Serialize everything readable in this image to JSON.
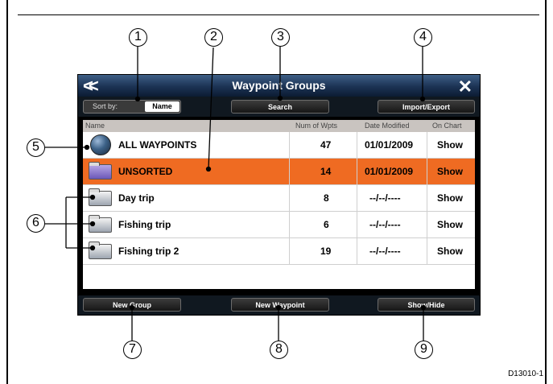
{
  "window": {
    "title": "Waypoint Groups"
  },
  "icons": {
    "back": "double-chevron-left-icon",
    "close": "close-x-icon"
  },
  "toolbar": {
    "sort_label": "Sort by:",
    "sort_value": "Name",
    "search_label": "Search",
    "import_export_label": "Import/Export"
  },
  "table": {
    "headers": [
      "Name",
      "Num of Wpts",
      "Date Modified",
      "On Chart"
    ],
    "rows": [
      {
        "name": "ALL WAYPOINTS",
        "num": "47",
        "date": "01/01/2009",
        "on_chart": "Show",
        "icon": "globe-icon"
      },
      {
        "name": "UNSORTED",
        "num": "14",
        "date": "01/01/2009",
        "on_chart": "Show",
        "icon": "folder-icon"
      },
      {
        "name": "Day trip",
        "num": "8",
        "date": "--/--/----",
        "on_chart": "Show",
        "icon": "folder-icon"
      },
      {
        "name": "Fishing trip",
        "num": "6",
        "date": "--/--/----",
        "on_chart": "Show",
        "icon": "folder-icon"
      },
      {
        "name": "Fishing trip 2",
        "num": "19",
        "date": "--/--/----",
        "on_chart": "Show",
        "icon": "folder-icon"
      }
    ]
  },
  "bottom": {
    "new_group_label": "New Group",
    "new_waypoint_label": "New Waypoint",
    "show_hide_label": "Show/Hide"
  },
  "callouts": [
    "1",
    "2",
    "3",
    "4",
    "5",
    "6",
    "7",
    "8",
    "9"
  ],
  "doc_code": "D13010-1",
  "colors": {
    "selected_row": "#ef6b22",
    "titlebar": "#1b3253"
  }
}
